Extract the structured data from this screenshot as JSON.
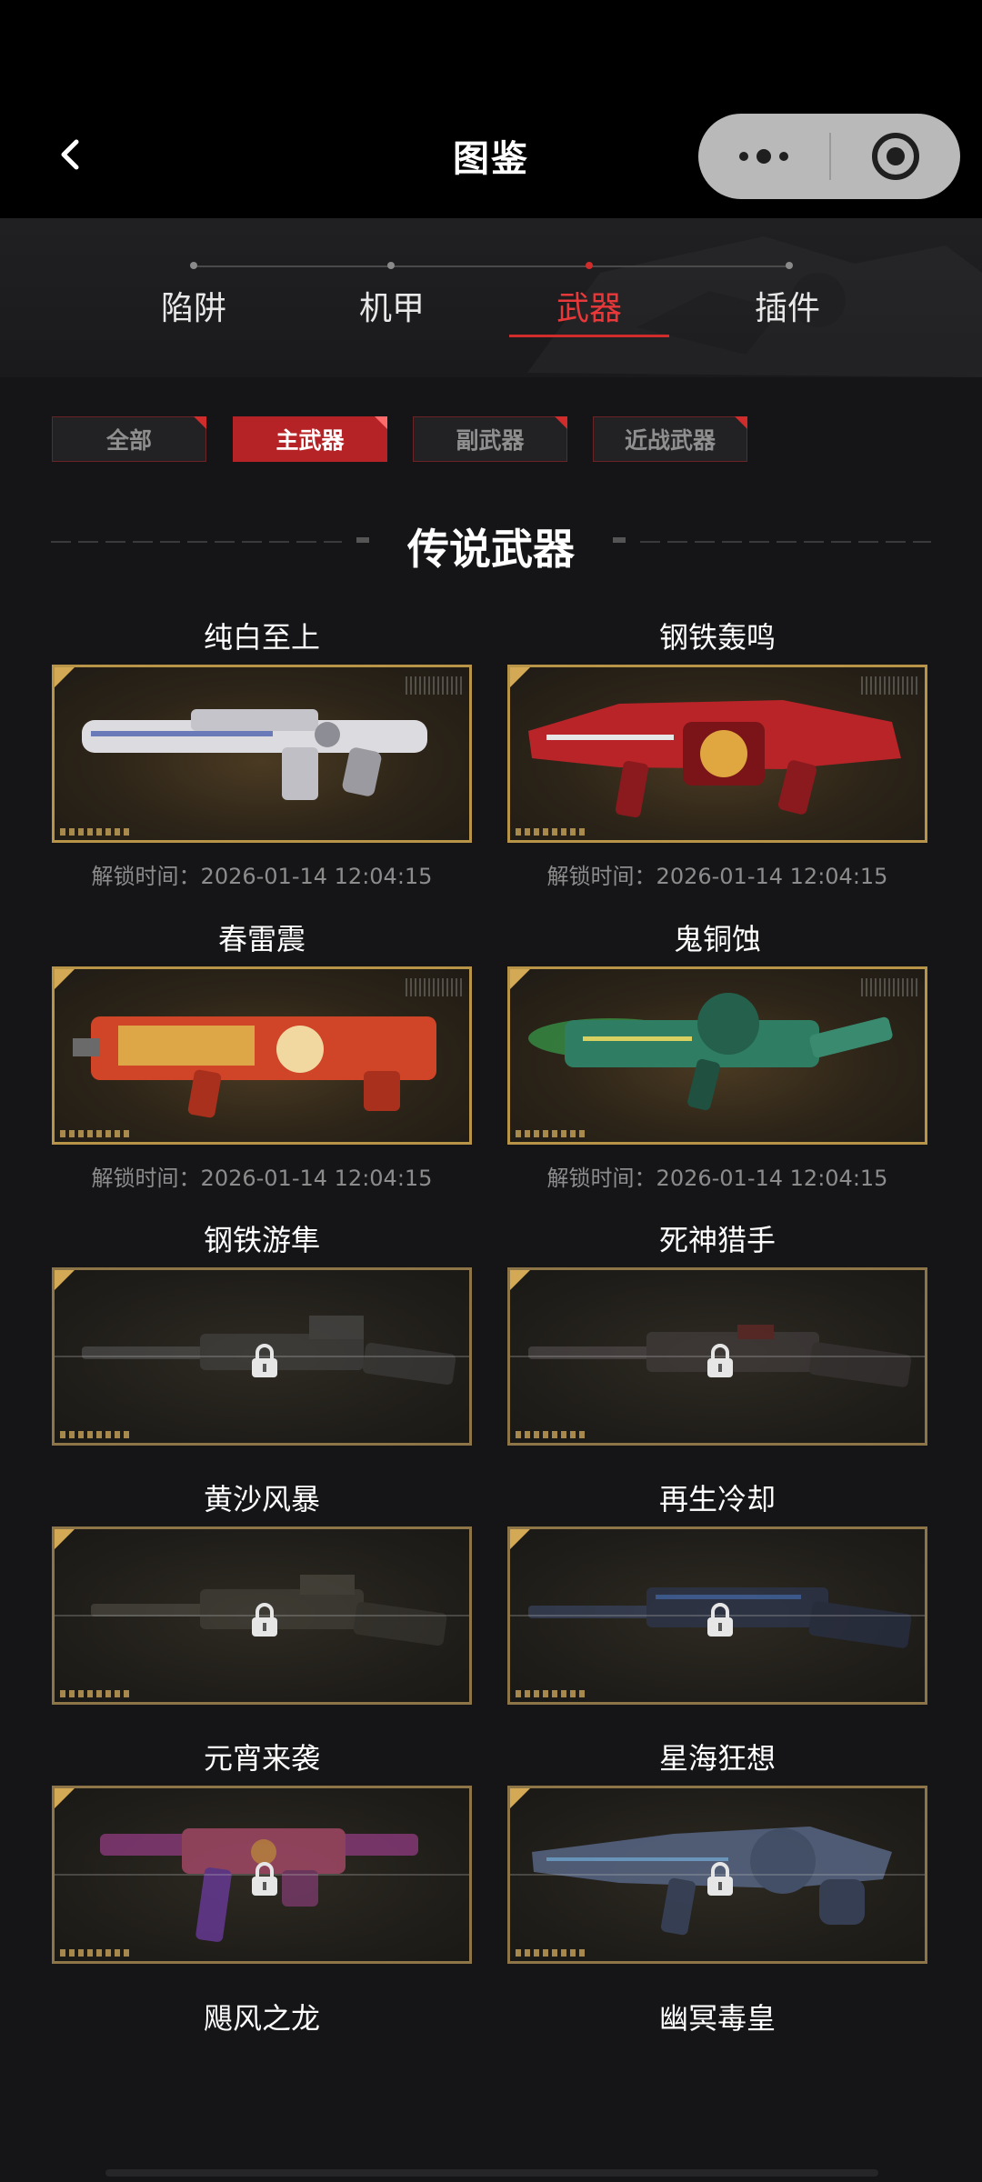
{
  "header": {
    "title": "图鉴"
  },
  "tabs": [
    {
      "label": "陷阱",
      "active": false
    },
    {
      "label": "机甲",
      "active": false
    },
    {
      "label": "武器",
      "active": true
    },
    {
      "label": "插件",
      "active": false
    }
  ],
  "filters": [
    {
      "label": "全部",
      "active": false
    },
    {
      "label": "主武器",
      "active": true
    },
    {
      "label": "副武器",
      "active": false
    },
    {
      "label": "近战武器",
      "active": false
    }
  ],
  "section": {
    "title": "传说武器"
  },
  "weapons": [
    {
      "name": "纯白至上",
      "locked": false,
      "unlock_text": "解锁时间：2026-01-14 12:04:15",
      "color": "#d8d8dc"
    },
    {
      "name": "钢铁轰鸣",
      "locked": false,
      "unlock_text": "解锁时间：2026-01-14 12:04:15",
      "color": "#c0282c"
    },
    {
      "name": "春雷震",
      "locked": false,
      "unlock_text": "解锁时间：2026-01-14 12:04:15",
      "color": "#d84a2a"
    },
    {
      "name": "鬼铜蚀",
      "locked": false,
      "unlock_text": "解锁时间：2026-01-14 12:04:15",
      "color": "#2f7d62"
    },
    {
      "name": "钢铁游隼",
      "locked": true,
      "color": "#4a4a4a"
    },
    {
      "name": "死神猎手",
      "locked": true,
      "color": "#4a4446"
    },
    {
      "name": "黄沙风暴",
      "locked": true,
      "color": "#4a4840"
    },
    {
      "name": "再生冷却",
      "locked": true,
      "color": "#3c4a6a"
    },
    {
      "name": "元宵来袭",
      "locked": true,
      "color": "#8a3a7a"
    },
    {
      "name": "星海狂想",
      "locked": true,
      "color": "#5a6a8a"
    },
    {
      "name": "飓风之龙",
      "locked": true
    },
    {
      "name": "幽冥毒皇",
      "locked": true
    }
  ]
}
